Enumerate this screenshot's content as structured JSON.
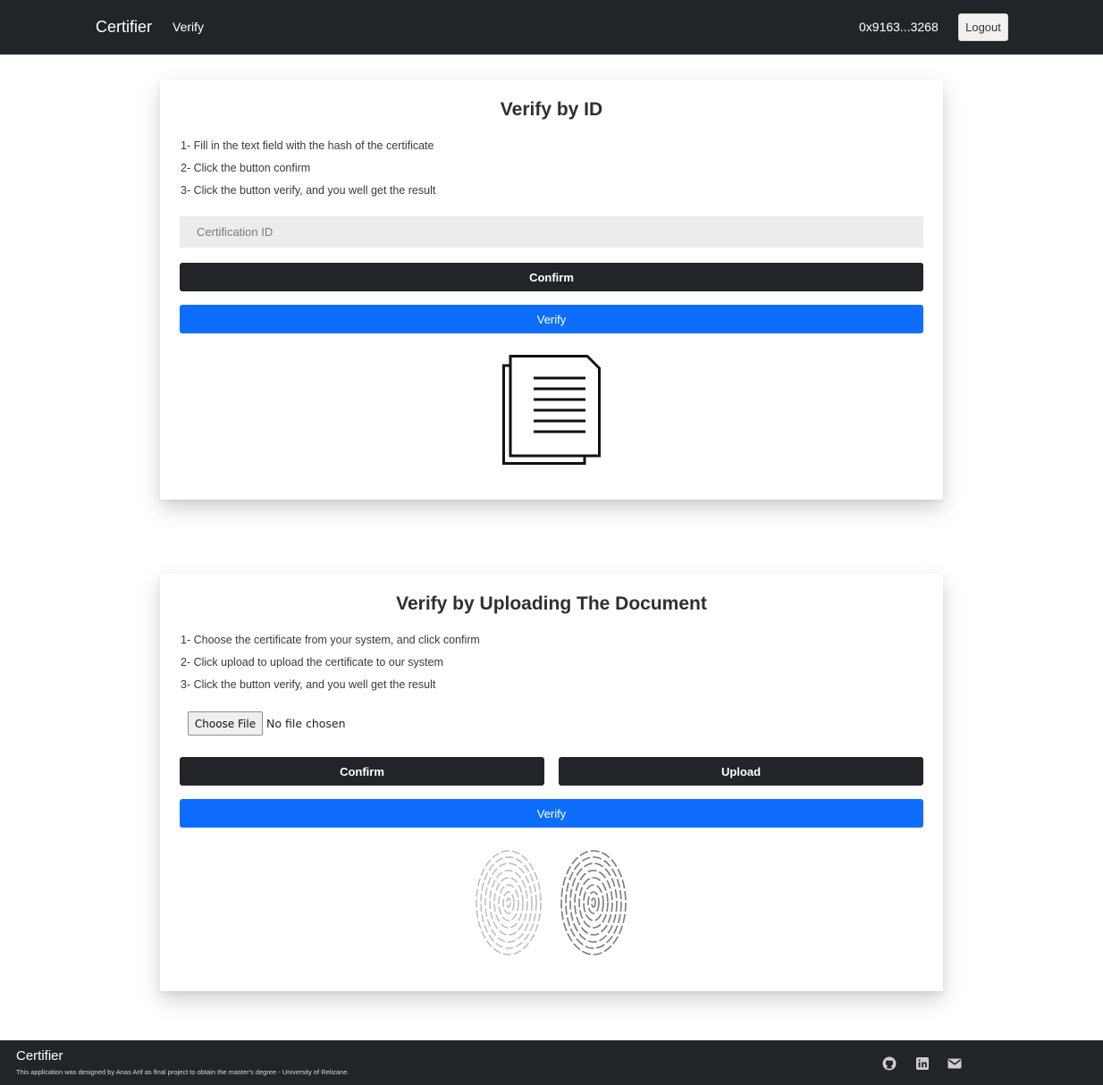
{
  "navbar": {
    "brand": "Certifier",
    "links": [
      "Verify"
    ],
    "account": "0x9163...3268",
    "logout_label": "Logout"
  },
  "verify_by_id": {
    "title": "Verify by ID",
    "steps": [
      "1- Fill in the text field with the hash of the certificate",
      "2- Click the button confirm",
      "3- Click the button verify, and you well get the result"
    ],
    "input_placeholder": "Certification ID",
    "input_value": "",
    "confirm_label": "Confirm",
    "verify_label": "Verify",
    "illustration": "documents-icon"
  },
  "verify_by_upload": {
    "title": "Verify by Uploading The Document",
    "steps": [
      "1- Choose the certificate from your system, and click confirm",
      "2- Click upload to upload the certificate to our system",
      "3- Click the button verify, and you well get the result"
    ],
    "choose_file_label": "Choose File",
    "file_status": "No file chosen",
    "confirm_label": "Confirm",
    "upload_label": "Upload",
    "verify_label": "Verify",
    "illustration": "fingerprints-icon"
  },
  "footer": {
    "brand": "Certifier",
    "note": "This application was designed by Anas Arif as final project to obtain the master's degree - University of Relizane.",
    "social_icons": [
      "github-icon",
      "linkedin-icon",
      "mail-icon"
    ]
  },
  "colors": {
    "navbar_bg": "#212529",
    "primary": "#0d6efd",
    "dark_button": "#212529"
  }
}
